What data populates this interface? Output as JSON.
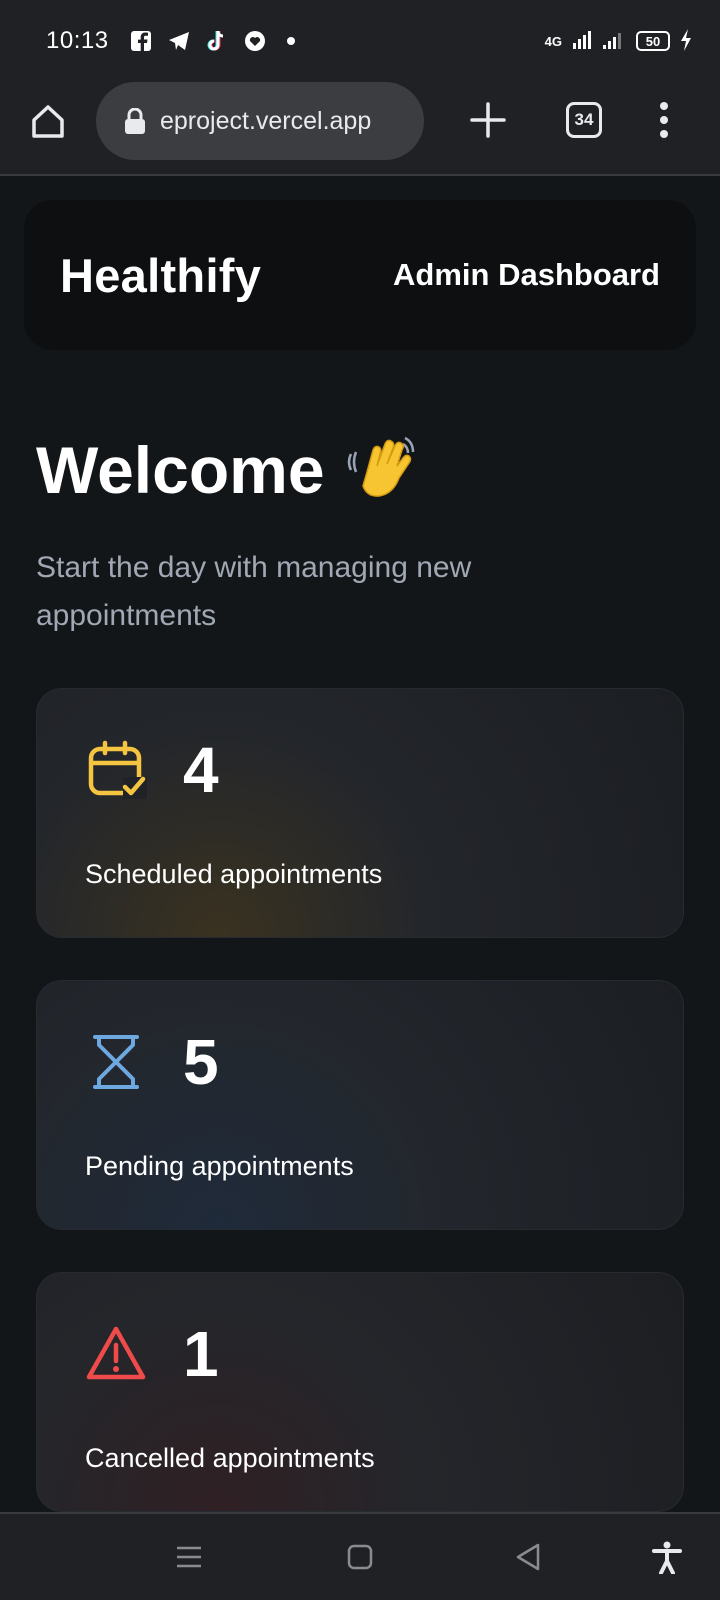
{
  "status_bar": {
    "time": "10:13",
    "network": "4G",
    "battery": "50"
  },
  "browser": {
    "url": "eproject.vercel.app",
    "tab_count": "34"
  },
  "header": {
    "brand": "Healthify",
    "subtitle": "Admin Dashboard"
  },
  "welcome": {
    "title": "Welcome",
    "emoji_icon": "waving-hand-icon",
    "subtitle": "Start the day with managing new appointments"
  },
  "stats": [
    {
      "icon": "calendar-check-icon",
      "count": "4",
      "label": "Scheduled appointments",
      "color": "#f5c542"
    },
    {
      "icon": "hourglass-icon",
      "count": "5",
      "label": "Pending appointments",
      "color": "#6ea8e0"
    },
    {
      "icon": "warning-triangle-icon",
      "count": "1",
      "label": "Cancelled appointments",
      "color": "#f04b4b"
    }
  ]
}
